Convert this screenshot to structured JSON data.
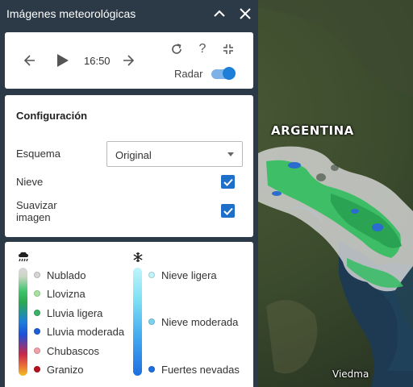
{
  "app": {
    "title": "Imágenes meteorológicas"
  },
  "window_controls": {
    "collapse_icon": "chevron-up-icon",
    "close_icon": "close-icon"
  },
  "player": {
    "time": "16:50",
    "radar_label": "Radar",
    "radar_enabled": true,
    "icons": [
      "chevron-left-icon",
      "play-icon",
      "chevron-right-icon",
      "refresh-icon",
      "help-icon",
      "exit-fullscreen-icon"
    ]
  },
  "config": {
    "heading": "Configuración",
    "scheme_label": "Esquema",
    "scheme_value": "Original",
    "snow_label": "Nieve",
    "snow_checked": true,
    "smooth_label": "Suavizar imagen",
    "smooth_checked": true
  },
  "legend": {
    "rain": [
      {
        "label": "Nublado",
        "color": "#d6d6d6"
      },
      {
        "label": "Llovizna",
        "color": "#a6e3a0"
      },
      {
        "label": "Lluvia ligera",
        "color": "#3db36a"
      },
      {
        "label": "Lluvia moderada",
        "color": "#1e5fd8"
      },
      {
        "label": "Chubascos",
        "color": "#f2a0a8"
      },
      {
        "label": "Granizo",
        "color": "#b8101e"
      }
    ],
    "snow": [
      {
        "label": "Nieve ligera",
        "color": "#bff4fa"
      },
      {
        "label": "Nieve moderada",
        "color": "#7dd3f0"
      },
      {
        "label": "Fuertes nevadas",
        "color": "#1e6fe0"
      }
    ]
  },
  "map": {
    "country_label": "ARGENTINA",
    "city_label": "Viedma"
  },
  "colors": {
    "panel_bg": "#2b3a46",
    "accent": "#1e7fd8"
  }
}
